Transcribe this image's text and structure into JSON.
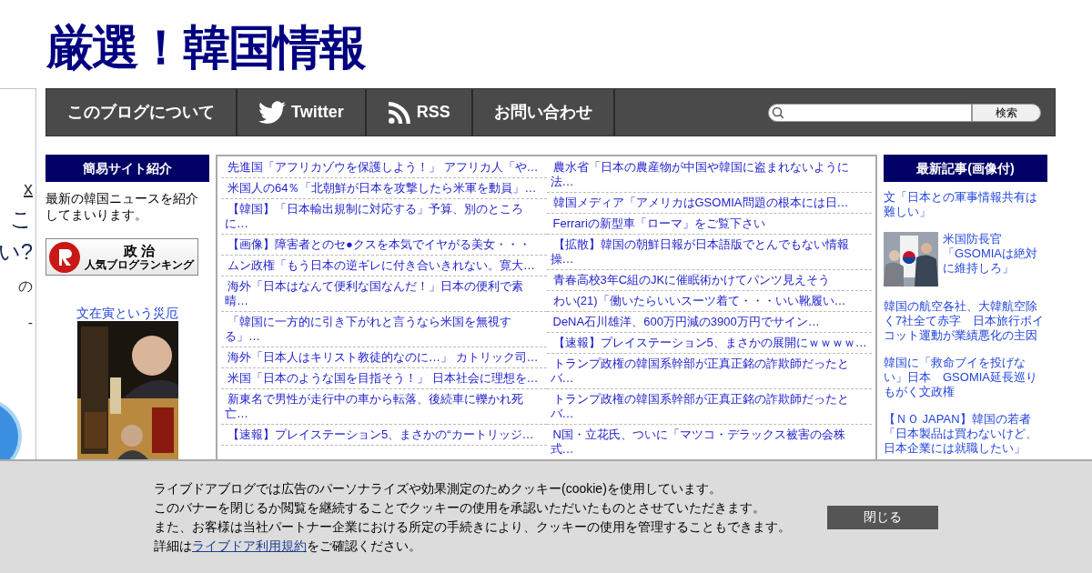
{
  "site_title": "厳選！韓国情報",
  "left_ad_fragments": [
    {
      "text": "x",
      "kind": "link"
    },
    {
      "text": "こ",
      "kind": "big"
    },
    {
      "text": "い?",
      "kind": "big"
    },
    {
      "text": "の",
      "kind": "plain"
    },
    {
      "text": "-",
      "kind": "plain"
    }
  ],
  "nav": [
    {
      "label": "このブログについて",
      "kind": "text"
    },
    {
      "label": "Twitter",
      "kind": "twitter"
    },
    {
      "label": "RSS",
      "kind": "rss"
    },
    {
      "label": "お問い合わせ",
      "kind": "text"
    }
  ],
  "search": {
    "button": "検索"
  },
  "left_sidebar": {
    "heading": "簡易サイト紹介",
    "intro": "最新の韓国ニュースを紹介してまいります。",
    "ranking_banner": {
      "line_1": "政 治",
      "line_2": "人気ブログランキング"
    },
    "book": {
      "title": "文在寅という災厄"
    }
  },
  "articles_left": [
    {
      "title": "先進国「アフリカゾウを保護しよう！」 アフリカ人「や…"
    },
    {
      "title": "米国人の64％「北朝鮮が日本を攻撃したら米軍を動員」…"
    },
    {
      "title": "【韓国】「日本輸出規制に対応する」予算、別のところに…"
    },
    {
      "title": "【画像】障害者とのセ●クスを本気でイヤがる美女・・・"
    },
    {
      "title": "ムン政権「もう日本の逆ギレに付き合いきれない。寛大…"
    },
    {
      "title": "海外「日本はなんて便利な国なんだ！」日本の便利で素晴…"
    },
    {
      "title": "「韓国に一方的に引き下がれと言うなら米国を無視する」…"
    },
    {
      "title": "海外「日本人はキリスト教徒的なのに…」 カトリック司…"
    },
    {
      "title": "米国「日本のような国を目指そう！」 日本社会に理想を…"
    },
    {
      "title": "新東名で男性が走行中の車から転落、後続車に轢かれ死亡…"
    },
    {
      "title": "【速報】プレイステーション5、まさかの“カートリッジ…"
    }
  ],
  "articles_right": [
    {
      "title": "農水省「日本の農産物が中国や韓国に盗まれないように法…"
    },
    {
      "title": "韓国メディア「アメリカはGSOMIA問題の根本には日…"
    },
    {
      "title": "Ferrariの新型車「ローマ」をご覧下さい"
    },
    {
      "title": "【拡散】韓国の朝鮮日報が日本語版でとんでもない情報操…"
    },
    {
      "title": "青春高校3年C組のJKに催眠術かけてパンツ見えそう"
    },
    {
      "title": "わい(21)「働いたらいいスーツ着て・・・いい靴履い…"
    },
    {
      "title": "DeNA石川雄洋、600万円減の3900万円でサイン…"
    },
    {
      "title": "【速報】プレイステーション5、まさかの展開にｗｗｗｗ…"
    },
    {
      "title": "トランプ政権の韓国系幹部が正真正銘の詐欺師だったとバ…"
    },
    {
      "title": "トランプ政権の韓国系幹部が正真正銘の詐欺師だったとバ…"
    },
    {
      "title": "N国・立花氏、ついに「マツコ・デラックス被害の会株式…"
    }
  ],
  "right_sidebar": {
    "heading": "最新記事(画像付)",
    "items": [
      {
        "title": "文「日本との軍事情報共有は難しい」",
        "kind": "text"
      },
      {
        "title": "米国防長官「GSOMIAは絶対に維持しろ」"
      },
      {
        "title": "韓国の航空各社、大韓航空除く7社全て赤字　日本旅行ボイコット運動が業績悪化の主因",
        "kind": "text"
      },
      {
        "title": "韓国に「救命ブイを投げない」日本　GSOMIA延長巡りもがく文政権",
        "kind": "text"
      },
      {
        "title": "【ＮＯ JAPAN】韓国の若者「日本製品は買わないけど、日本企業には就職したい」",
        "kind": "text"
      }
    ]
  },
  "cookie_banner": {
    "lines": [
      "ライブドアブログでは広告のパーソナライズや効果測定のためクッキー(cookie)を使用しています。",
      "このバナーを閉じるか閲覧を継続することでクッキーの使用を承認いただいたものとさせていただきます。",
      "また、お客様は当社パートナー企業における所定の手続きにより、クッキーの使用を管理することもできます。"
    ],
    "last_line": {
      "before": "詳細は",
      "link": "ライブドア利用規約",
      "after": "をご確認ください。"
    },
    "close_button": "閉じる"
  }
}
